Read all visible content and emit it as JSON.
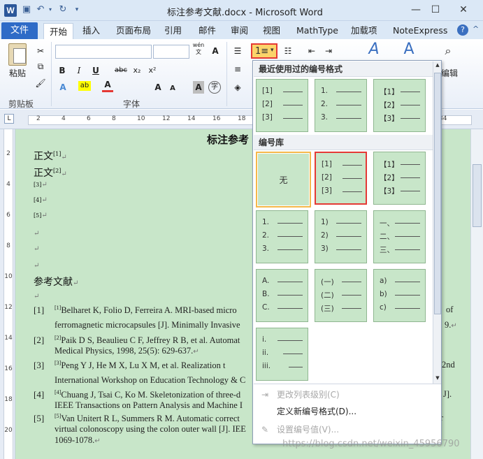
{
  "window": {
    "app_icon_letter": "W",
    "title": "标注参考文献.docx - Microsoft Word",
    "minimize": "—",
    "maximize": "☐",
    "close": "✕"
  },
  "tabs": {
    "file": "文件",
    "items": [
      "开始",
      "插入",
      "页面布局",
      "引用",
      "邮件",
      "审阅",
      "视图",
      "MathType",
      "加载项",
      "NoteExpress"
    ],
    "active_index": 0,
    "help": "?",
    "minimize_ribbon": "^"
  },
  "ribbon": {
    "clipboard_label": "剪贴板",
    "paste_label": "粘贴",
    "font_label": "字体",
    "font_small": "wén",
    "font_big": "文",
    "bold": "B",
    "italic": "I",
    "underline": "U",
    "strike": "abc",
    "subscript": "x₂",
    "superscript": "x²",
    "grow_font": "A",
    "shrink_font": "A",
    "char_border": "A",
    "phonetic": "字",
    "edit_label": "编辑",
    "numbering_icon": "1≡",
    "numbering_arrow": "▾"
  },
  "ruler": {
    "tab_selector": "L",
    "h_numbers": [
      "2",
      "4",
      "6",
      "8",
      "10",
      "12",
      "14",
      "16",
      "18",
      "20",
      "22",
      "24",
      "26",
      "28",
      "30",
      "32",
      "34"
    ],
    "v_numbers": [
      "2",
      "4",
      "6",
      "8",
      "10",
      "12",
      "14",
      "16",
      "18",
      "20"
    ]
  },
  "document": {
    "title": "标注参考",
    "body_1": "正文",
    "sup_1": "[1]",
    "body_2": "正文",
    "sup_2": "[2]",
    "marks": [
      "[3]",
      "[4]",
      "[5]"
    ],
    "section_title": "参考文献",
    "refs": [
      {
        "num": "[1]",
        "sup": "[1]",
        "line1": "Belharet K, Folio D, Ferreira A. MRI-based micro",
        "line1_tail": "of",
        "line2": "ferromagnetic microcapsules [J]. Minimally Invasive",
        "line2_tail": "9."
      },
      {
        "num": "[2]",
        "sup": "[2]",
        "line1": "Paik D S, Beaulieu C F, Jeffrey R B, et al. Automat",
        "line1_tail": "",
        "line2": "Medical Physics, 1998, 25(5): 629-637.",
        "line2_tail": ""
      },
      {
        "num": "[3]",
        "sup": "[3]",
        "line1": "Peng Y J, He M X, Lu X M, et al. Realization t",
        "line1_tail": "2nd",
        "line2": "International Workshop on Education Technology & C",
        "line2_tail": ""
      },
      {
        "num": "[4]",
        "sup": "[4]",
        "line1": "Chuang J, Tsai C, Ko M. Skeletonization of three-d",
        "line1_tail": "J].",
        "line2": "IEEE Transactions on Pattern Analysis and Machine I",
        "line2_tail": ""
      },
      {
        "num": "[5]",
        "sup": "[5]",
        "line1": "Van Unitert R L, Summers R M. Automatic correct",
        "line1_tail": "r",
        "line2": "virtual colonoscopy using the colon outer wall [J]. IEE",
        "line2_tail": "",
        "line3": "1069-1078."
      }
    ]
  },
  "gallery": {
    "recent_header": "最近使用过的编号格式",
    "library_header": "编号库",
    "recent_tiles": [
      [
        "[1]",
        "[2]",
        "[3]"
      ],
      [
        "1.",
        "2.",
        "3."
      ],
      [
        "【1】",
        "【2】",
        "【3】"
      ]
    ],
    "none_label": "无",
    "library_tiles": [
      [
        "[1]",
        "[2]",
        "[3]"
      ],
      [
        "【1】",
        "【2】",
        "【3】"
      ],
      [
        "1.",
        "2.",
        "3."
      ],
      [
        "1)",
        "2)",
        "3)"
      ],
      [
        "一、",
        "二、",
        "三、"
      ],
      [
        "A.",
        "B.",
        "C."
      ],
      [
        "(一)",
        "(二)",
        "(三)"
      ],
      [
        "a)",
        "b)",
        "c)"
      ],
      [
        "i.",
        "ii.",
        "iii."
      ]
    ],
    "menu": [
      {
        "label": "更改列表级别(C)",
        "disabled": true,
        "icon": "⇥"
      },
      {
        "label": "定义新编号格式(D)...",
        "disabled": false,
        "icon": ""
      },
      {
        "label": "设置编号值(V)...",
        "disabled": true,
        "icon": "✎"
      }
    ]
  },
  "watermark": "https://blog.csdn.net/weixin_45956790",
  "colors": {
    "doc_background": "#c8e6c9",
    "highlight_border": "#e53935",
    "selected_tile_border": "#f5b84a",
    "file_tab": "#2e6bc7"
  }
}
